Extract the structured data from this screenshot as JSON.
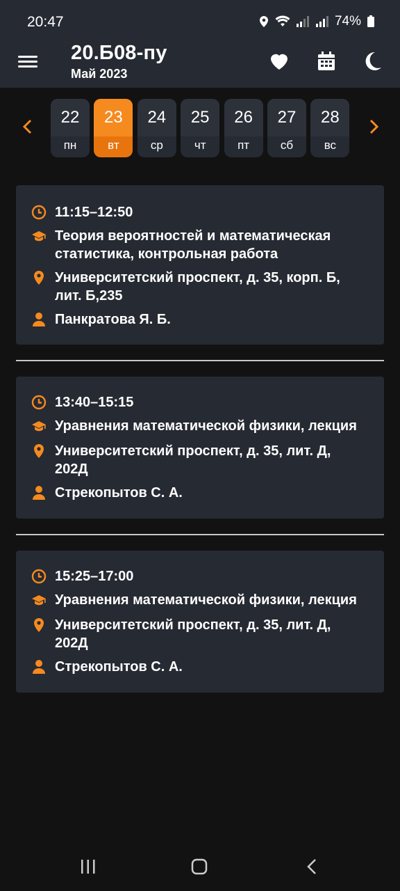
{
  "status_bar": {
    "time": "20:47",
    "battery": "74%"
  },
  "header": {
    "title": "20.Б08-пу",
    "subtitle": "Май 2023"
  },
  "days": [
    {
      "num": "22",
      "dow": "пн",
      "active": false
    },
    {
      "num": "23",
      "dow": "вт",
      "active": true
    },
    {
      "num": "24",
      "dow": "ср",
      "active": false
    },
    {
      "num": "25",
      "dow": "чт",
      "active": false
    },
    {
      "num": "26",
      "dow": "пт",
      "active": false
    },
    {
      "num": "27",
      "dow": "сб",
      "active": false
    },
    {
      "num": "28",
      "dow": "вс",
      "active": false
    }
  ],
  "lessons": [
    {
      "time": "11:15–12:50",
      "subject": "Теория вероятностей и математическая статистика, контрольная работа",
      "location": "Университетский проспект, д. 35, корп. Б, лит. Б,235",
      "teacher": "Панкратова Я. Б."
    },
    {
      "time": "13:40–15:15",
      "subject": "Уравнения математической физики, лекция",
      "location": "Университетский проспект, д. 35, лит. Д, 202Д",
      "teacher": "Стрекопытов С. А."
    },
    {
      "time": "15:25–17:00",
      "subject": "Уравнения математической физики, лекция",
      "location": "Университетский проспект, д. 35, лит. Д, 202Д",
      "teacher": "Стрекопытов С. А."
    }
  ],
  "colors": {
    "accent": "#f58a1f",
    "surface": "#262a33",
    "background": "#121212"
  },
  "icons": {
    "time": "clock-icon",
    "subject": "graduation-cap-icon",
    "location": "location-pin-icon",
    "teacher": "person-icon"
  }
}
